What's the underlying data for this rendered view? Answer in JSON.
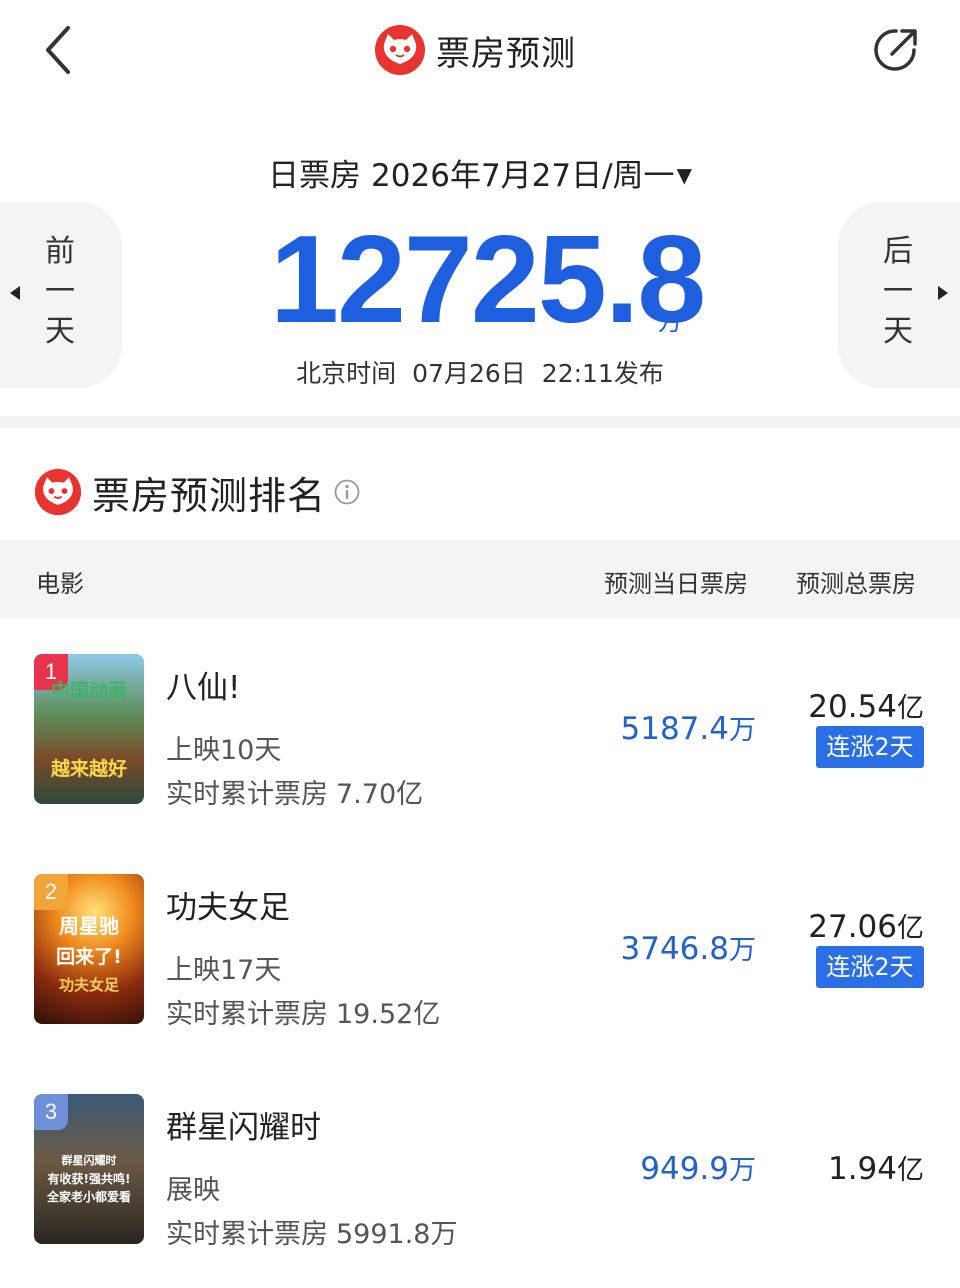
{
  "header": {
    "title": "票房预测"
  },
  "summary": {
    "label": "日票房",
    "date": "2026年7月27日/周一",
    "prev_label": "前一天",
    "next_label": "后一天",
    "total": "12725.8",
    "unit": "万",
    "publish_prefix": "北京时间",
    "publish_date": "07月26日",
    "publish_time": "22:11发布"
  },
  "ranking": {
    "title": "票房预测排名",
    "columns": {
      "movie": "电影",
      "day_box": "预测当日票房",
      "total_box": "预测总票房"
    },
    "movies": [
      {
        "rank": "1",
        "title": "八仙!",
        "days": "上映10天",
        "cum_label": "实时累计票房",
        "cum_value": "7.70亿",
        "day_value": "5187.4",
        "day_unit": "万",
        "total_value": "20.54",
        "total_unit": "亿",
        "trend": "连涨2天",
        "poster_text": [
          "中国动画",
          "越来越好"
        ]
      },
      {
        "rank": "2",
        "title": "功夫女足",
        "days": "上映17天",
        "cum_label": "实时累计票房",
        "cum_value": "19.52亿",
        "day_value": "3746.8",
        "day_unit": "万",
        "total_value": "27.06",
        "total_unit": "亿",
        "trend": "连涨2天",
        "poster_text": [
          "周星驰",
          "回来了!",
          "功夫女足"
        ]
      },
      {
        "rank": "3",
        "title": "群星闪耀时",
        "days": "展映",
        "cum_label": "实时累计票房",
        "cum_value": "5991.8万",
        "day_value": "949.9",
        "day_unit": "万",
        "total_value": "1.94",
        "total_unit": "亿",
        "trend": "",
        "poster_text": [
          "群星闪耀时",
          "有收获!强共鸣!",
          "全家老小都爱看"
        ]
      }
    ]
  },
  "colors": {
    "accent": "#1e5fe0",
    "trend_badge": "#2a6fe6",
    "brand_red": "#e8332f",
    "rank1": "#e8334a",
    "rank2": "#f0a43a",
    "rank3": "#6f8fd8"
  }
}
